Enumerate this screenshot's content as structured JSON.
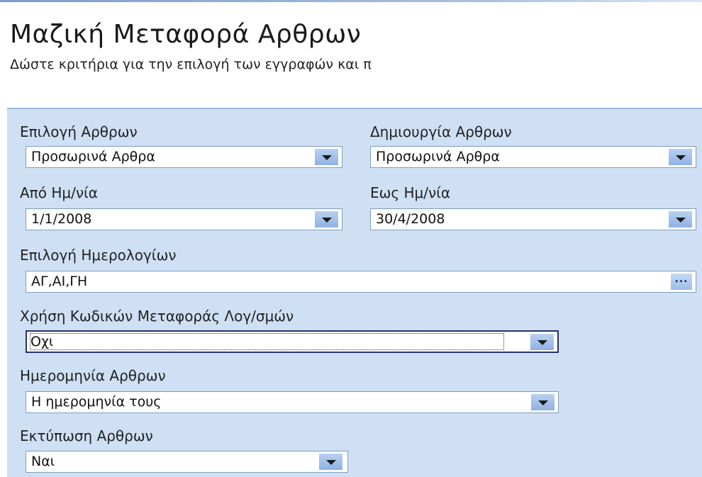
{
  "header": {
    "title": "Μαζική Μεταφορά Αρθρων",
    "subtitle": "Δώστε κριτήρια για την επιλογή των εγγραφών και π"
  },
  "form": {
    "selection_label": "Επιλογή Αρθρων",
    "selection_value": "Προσωρινά Αρθρα",
    "creation_label": "Δημιουργία Αρθρων",
    "creation_value": "Προσωρινά Αρθρα",
    "from_date_label": "Από Ημ/νία",
    "from_date_value": "1/1/2008",
    "to_date_label": "Εως Ημ/νία",
    "to_date_value": "30/4/2008",
    "journals_label": "Επιλογή Ημερολογίων",
    "journals_value": "ΑΓ,ΑΙ,ΓΗ",
    "journals_browse": "...",
    "transfer_codes_label": "Χρήση Κωδικών Μεταφοράς Λογ/σμών",
    "transfer_codes_value": "Οχι",
    "entry_date_label": "Ημερομηνία Αρθρων",
    "entry_date_value": "Η ημερομηνία τους",
    "print_label": "Εκτύπωση Αρθρων",
    "print_value": "Ναι"
  },
  "icons": {
    "dropdown": "chevron-down-icon",
    "browse": "ellipsis-icon"
  }
}
